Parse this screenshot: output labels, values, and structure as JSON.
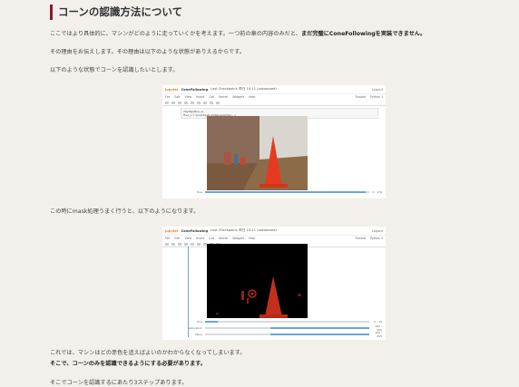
{
  "heading": "コーンの認識方法について",
  "paragraphs": {
    "p1_normal": "ここではより具体的に、マシンがどのように走っていくかを考えます。一つ前の章の内容のみだと、",
    "p1_bold": "まだ完璧にConeFollowingを実装できません。",
    "p2": "その理由をお伝えします。その理由は以下のような状態がありえるからです。",
    "p3": "以下のような状態でコーンを認識したいとします。",
    "p4": "この時にmask処理うまく行うと、以下のようになります。",
    "p5": "これでは、マシンはどの赤色を追えばよいのかわからなくなってしまいます。",
    "p6_bold": "そこで、コーンのみを認識できるようにする必要があります。",
    "p7": "そこでコーンを認識するにあたり3ステップあります。"
  },
  "screenshot1": {
    "logo": "jupyter",
    "title": "ConeFollowing",
    "subtitle": "Last Checkpoint: 昨日 10:11 (autosaved)",
    "logout": "Logout",
    "menu": [
      "File",
      "Edit",
      "View",
      "Insert",
      "Cell",
      "Kernel",
      "Widgets",
      "Help"
    ],
    "trusted": "Trusted",
    "kernel": "Python 3",
    "cell_prompt": "In [ ]:",
    "code_line1": "display(Hue_s)",
    "code_line2": "Hue_s = ipywidgets.IntRangeSlider(...)",
    "sliders": [
      {
        "label": "Hue",
        "value": "0 - 179",
        "fill": 0.98
      }
    ]
  },
  "screenshot2": {
    "logo": "jupyter",
    "title": "ConeFollowing",
    "subtitle": "Last Checkpoint: 昨日 10:11 (autosaved)",
    "logout": "Logout",
    "menu": [
      "File",
      "Edit",
      "View",
      "Insert",
      "Cell",
      "Kernel",
      "Widgets",
      "Help"
    ],
    "trusted": "Trusted",
    "kernel": "Python 3",
    "sliders": [
      {
        "label": "Hue",
        "value": "0 - 15",
        "fill": 0.08
      },
      {
        "label": "Saturation",
        "value": "100 - 255",
        "fill": 0.4
      },
      {
        "label": "Value",
        "value": "100 - 255",
        "fill": 0.4
      }
    ]
  },
  "colors": {
    "accent": "#8b1a2b",
    "cone": "#e53a1f",
    "slider_fill": "#6aa5dc"
  }
}
